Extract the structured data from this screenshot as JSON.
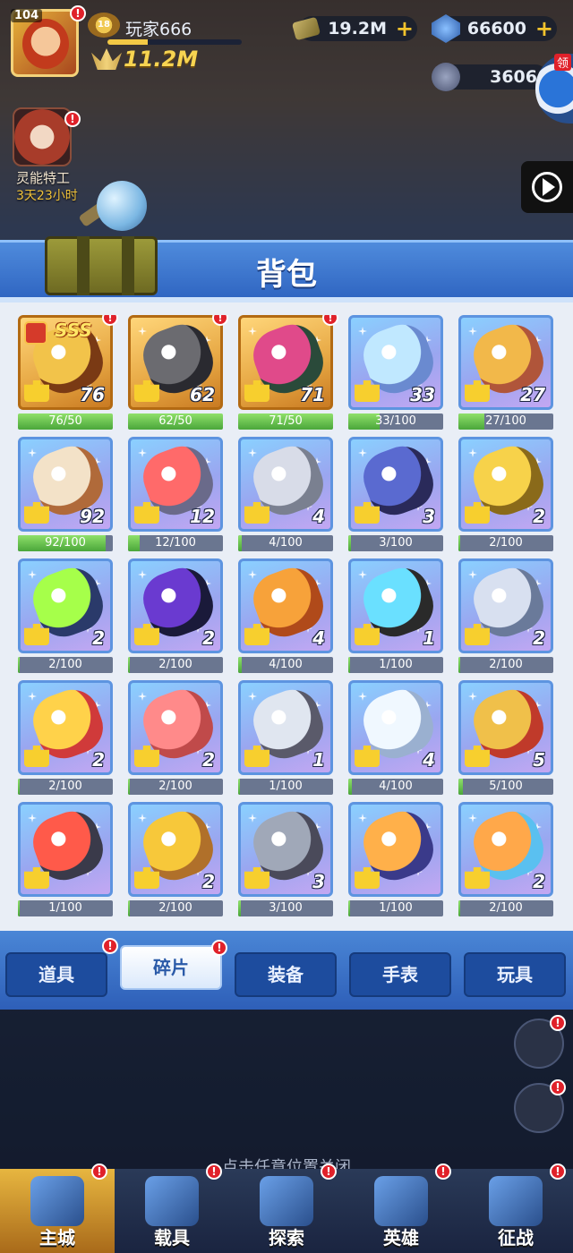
{
  "hud": {
    "level": "104",
    "player_name": "玩家666",
    "rank_badge": "18",
    "power": "11.2M",
    "cash": "19.2M",
    "gems": "66600",
    "tokens": "3606",
    "side_label": "领",
    "agent_title": "灵能特工",
    "agent_time": "3天23小时"
  },
  "panel": {
    "title": "背包"
  },
  "items": [
    {
      "count": "76",
      "progress": "76/50",
      "fill": 1.0,
      "frame": "gold",
      "sss": "SSS",
      "badge": true,
      "c1": "#f2c34a",
      "c2": "#7a3a14",
      "icon": "golden-mask-hero-icon"
    },
    {
      "count": "62",
      "progress": "62/50",
      "fill": 1.0,
      "frame": "gold",
      "badge": true,
      "c1": "#6b6b70",
      "c2": "#2a2a30",
      "icon": "gorilla-hero-icon"
    },
    {
      "count": "71",
      "progress": "71/50",
      "fill": 1.0,
      "frame": "gold",
      "badge": true,
      "c1": "#e04a8a",
      "c2": "#2a4a3a",
      "icon": "flower-monster-icon"
    },
    {
      "count": "33",
      "progress": "33/100",
      "fill": 0.33,
      "frame": "blue",
      "c1": "#c0e8ff",
      "c2": "#6a8ad0",
      "icon": "visor-gear-icon"
    },
    {
      "count": "27",
      "progress": "27/100",
      "fill": 0.27,
      "frame": "blue",
      "c1": "#f2b84a",
      "c2": "#b0553a",
      "icon": "golden-idol-icon"
    },
    {
      "count": "92",
      "progress": "92/100",
      "fill": 0.92,
      "frame": "blue",
      "c1": "#f3e2c8",
      "c2": "#b06a3a",
      "icon": "orb-drone-icon"
    },
    {
      "count": "12",
      "progress": "12/100",
      "fill": 0.12,
      "frame": "blue",
      "c1": "#ff6a6a",
      "c2": "#6a6a8a",
      "icon": "capsule-device-icon"
    },
    {
      "count": "4",
      "progress": "4/100",
      "fill": 0.04,
      "frame": "blue",
      "c1": "#d8dce8",
      "c2": "#7a8090",
      "icon": "controller-icon"
    },
    {
      "count": "3",
      "progress": "3/100",
      "fill": 0.03,
      "frame": "blue",
      "c1": "#5a6ad0",
      "c2": "#2a2a5a",
      "icon": "shield-badge-icon"
    },
    {
      "count": "2",
      "progress": "2/100",
      "fill": 0.02,
      "frame": "blue",
      "c1": "#f7d24a",
      "c2": "#8a6a1a",
      "icon": "winged-key-icon"
    },
    {
      "count": "2",
      "progress": "2/100",
      "fill": 0.02,
      "frame": "blue",
      "c1": "#a6ff4a",
      "c2": "#2a3a6a",
      "icon": "robot-eye-icon"
    },
    {
      "count": "2",
      "progress": "2/100",
      "fill": 0.02,
      "frame": "blue",
      "c1": "#6a3ad0",
      "c2": "#1a1a3a",
      "icon": "raven-icon"
    },
    {
      "count": "4",
      "progress": "4/100",
      "fill": 0.04,
      "frame": "blue",
      "c1": "#f7a23a",
      "c2": "#b04a1a",
      "icon": "golden-torch-icon"
    },
    {
      "count": "1",
      "progress": "1/100",
      "fill": 0.01,
      "frame": "blue",
      "c1": "#6ae0ff",
      "c2": "#2a2a2a",
      "icon": "blaster-icon"
    },
    {
      "count": "2",
      "progress": "2/100",
      "fill": 0.02,
      "frame": "blue",
      "c1": "#d8e0f0",
      "c2": "#6a7a9a",
      "icon": "chain-link-icon"
    },
    {
      "count": "2",
      "progress": "2/100",
      "fill": 0.02,
      "frame": "blue",
      "c1": "#ffd24a",
      "c2": "#d03a3a",
      "icon": "trident-icon"
    },
    {
      "count": "2",
      "progress": "2/100",
      "fill": 0.02,
      "frame": "blue",
      "c1": "#ff8a8a",
      "c2": "#c04a4a",
      "icon": "shark-spear-icon"
    },
    {
      "count": "1",
      "progress": "1/100",
      "fill": 0.01,
      "frame": "blue",
      "c1": "#e0e6f0",
      "c2": "#5a5a6a",
      "icon": "claw-grabber-icon"
    },
    {
      "count": "4",
      "progress": "4/100",
      "fill": 0.04,
      "frame": "blue",
      "c1": "#f0f8ff",
      "c2": "#9ab0d0",
      "icon": "ice-crystal-icon"
    },
    {
      "count": "5",
      "progress": "5/100",
      "fill": 0.05,
      "frame": "blue",
      "c1": "#f0c04a",
      "c2": "#c03a2a",
      "icon": "golden-compass-icon"
    },
    {
      "count": "",
      "progress": "1/100",
      "fill": 0.01,
      "frame": "blue",
      "c1": "#ff5a4a",
      "c2": "#3a3a4a",
      "icon": "arm-cannon-icon"
    },
    {
      "count": "2",
      "progress": "2/100",
      "fill": 0.02,
      "frame": "blue",
      "c1": "#f7c83a",
      "c2": "#b0702a",
      "icon": "golden-ankh-icon"
    },
    {
      "count": "3",
      "progress": "3/100",
      "fill": 0.03,
      "frame": "blue",
      "c1": "#a0a8b8",
      "c2": "#4a4a5a",
      "icon": "dagger-icon"
    },
    {
      "count": "",
      "progress": "1/100",
      "fill": 0.01,
      "frame": "blue",
      "c1": "#ffb04a",
      "c2": "#3a3a8a",
      "icon": "energy-ring-icon"
    },
    {
      "count": "2",
      "progress": "2/100",
      "fill": 0.02,
      "frame": "blue",
      "c1": "#ffa84a",
      "c2": "#5ac0f0",
      "icon": "crystal-wing-icon"
    }
  ],
  "tabs": [
    {
      "label": "道具",
      "active": false,
      "badge": false
    },
    {
      "label": "碎片",
      "active": true,
      "badge": true
    },
    {
      "label": "装备",
      "active": false,
      "badge": false
    },
    {
      "label": "手表",
      "active": false,
      "badge": false
    },
    {
      "label": "玩具",
      "active": false,
      "badge": false
    }
  ],
  "close_hint": "点击任意位置关闭",
  "bottom_nav": [
    {
      "label": "主城",
      "active": true,
      "badge": true
    },
    {
      "label": "载具",
      "active": false,
      "badge": true
    },
    {
      "label": "探索",
      "active": false,
      "badge": true
    },
    {
      "label": "英雄",
      "active": false,
      "badge": true
    },
    {
      "label": "征战",
      "active": false,
      "badge": true
    }
  ],
  "badge_mark": "!",
  "colors": {
    "accent_blue": "#3066c2",
    "progress_green": "#4aa63a",
    "badge_red": "#e0212a",
    "puzzle_yellow": "#f7cf2e"
  }
}
